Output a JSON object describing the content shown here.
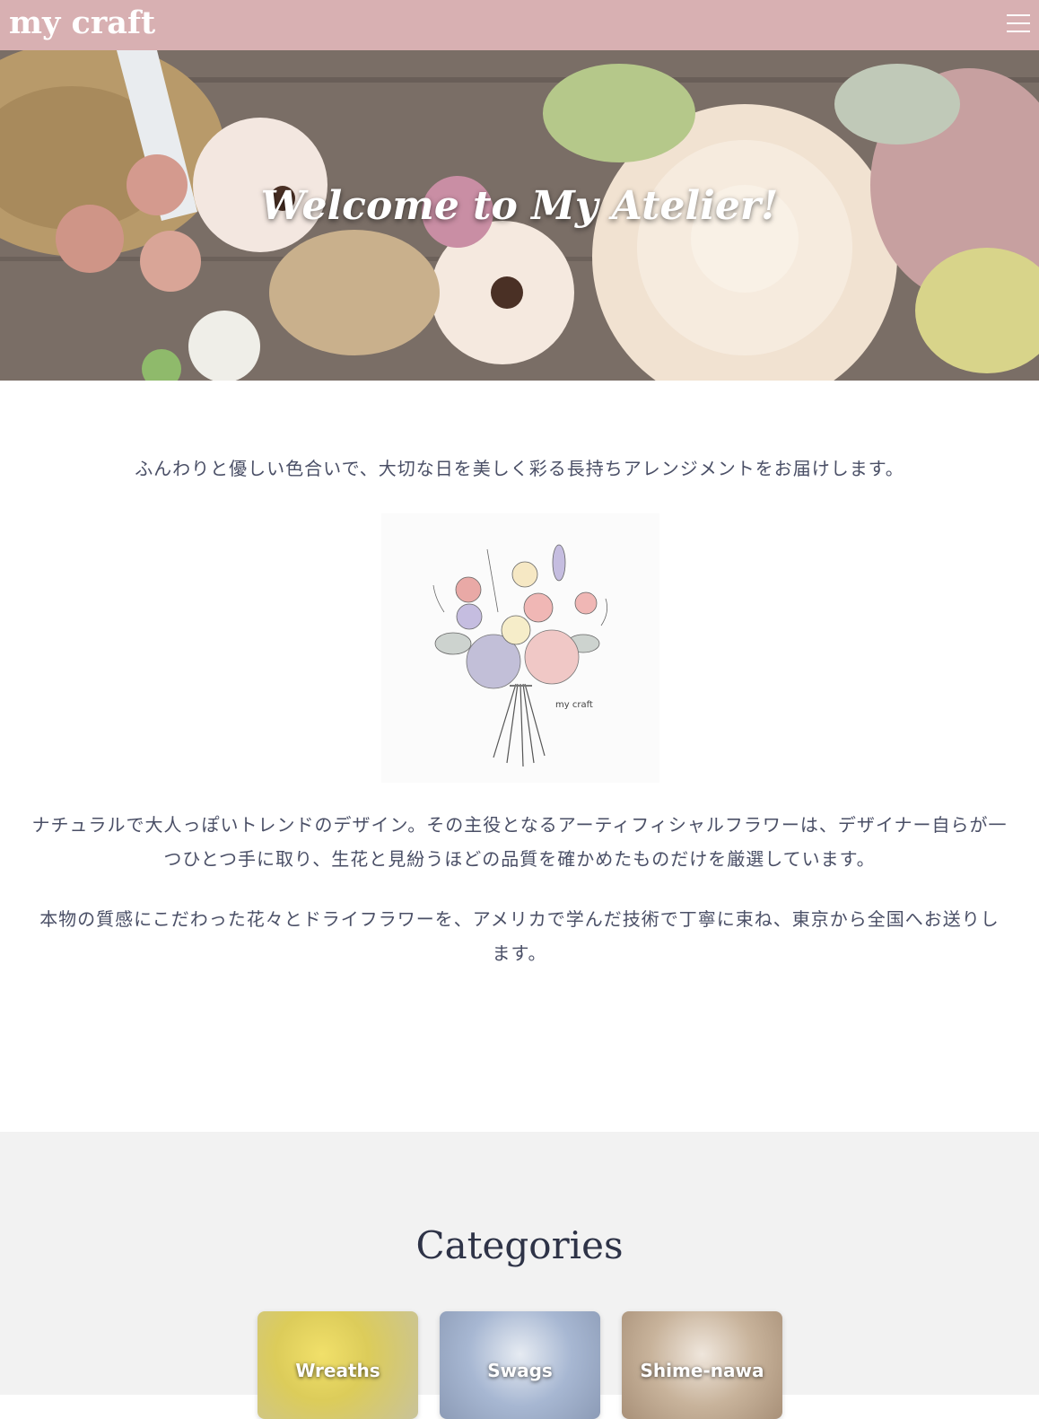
{
  "header": {
    "logo": "my craft",
    "menu_icon": "hamburger-menu-icon",
    "background_color": "#d8b0b2"
  },
  "hero": {
    "title": "Welcome to My Atelier!"
  },
  "intro": {
    "tagline": "ふんわりと優しい色合いで、大切な日を美しく彩る長持ちアレンジメントをお届けします。",
    "logo_caption": "my craft",
    "paragraph1_line1": "ナチュラルで大人っぽいトレンドのデザイン。その主役となるアーティフィシャルフラワーは、デザイナー自らが一",
    "paragraph1_line2": "つひとつ手に取り、生花と見紛うほどの品質を確かめたものだけを厳選しています。",
    "paragraph2_line1": "本物の質感にこだわった花々とドライフラワーを、アメリカで学んだ技術で丁寧に束ね、東京から全国へお送りし",
    "paragraph2_line2": "ます。"
  },
  "categories": {
    "title": "Categories",
    "items": [
      {
        "label": "Wreaths"
      },
      {
        "label": "Swags"
      },
      {
        "label": "Shime-nawa"
      }
    ]
  }
}
